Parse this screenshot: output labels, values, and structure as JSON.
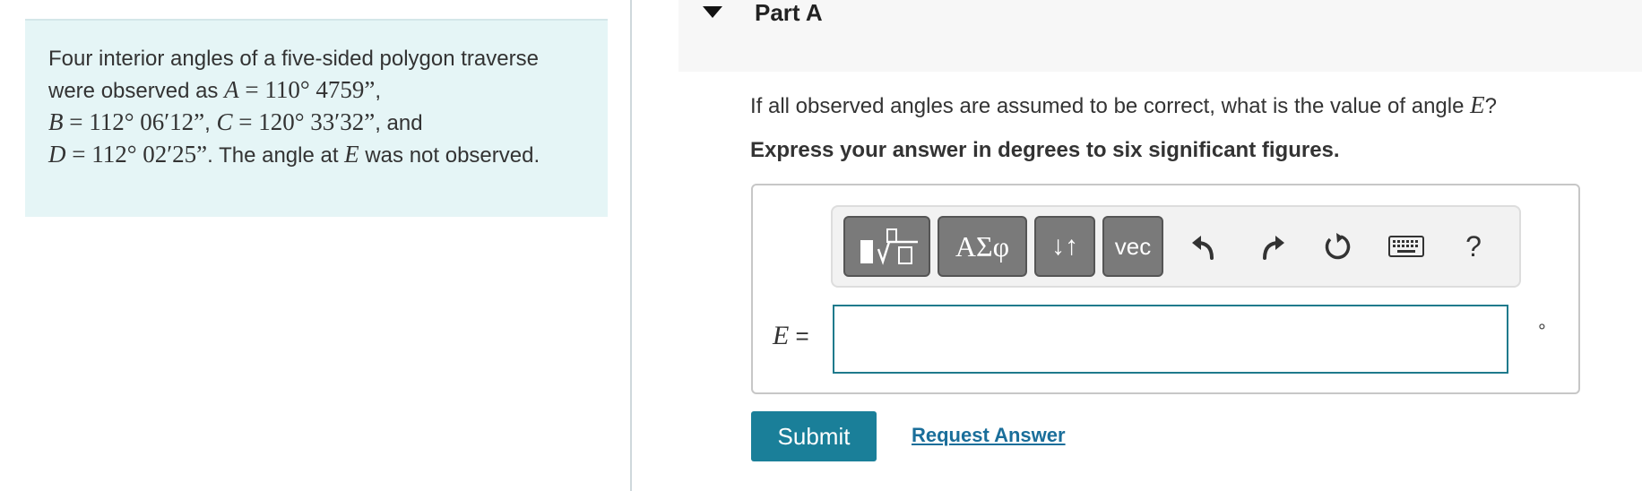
{
  "problem": {
    "t1": "Four interior angles of a five-sided polygon traverse were observed as ",
    "A_var": "A",
    "A_eq": " = 110° 4759”",
    "sep1": ",",
    "B_var": "B",
    "B_eq": " = 112° 06′12”",
    "sep2": ", ",
    "C_var": "C",
    "C_eq": " = 120° 33′32”",
    "sep3": ", and",
    "D_var": "D",
    "D_eq": " = 112° 02′25”",
    "t2": ". The angle at ",
    "E_var": "E",
    "t3": " was not observed."
  },
  "part": {
    "title": "Part A"
  },
  "question": {
    "text": "If all observed angles are assumed to be correct, what is the value of angle ",
    "var": "E",
    "end": "?"
  },
  "instruction": "Express your answer in degrees to six significant figures.",
  "toolbar": {
    "greek_label": "ΑΣφ",
    "arrows_label": "↓↑",
    "vec_label": "vec",
    "help_label": "?"
  },
  "answer": {
    "var": "E",
    "equals": " =",
    "value": "",
    "unit": "°"
  },
  "buttons": {
    "submit": "Submit",
    "request": "Request Answer"
  },
  "colors": {
    "panel_bg": "#e5f5f6",
    "submit_bg": "#1a7f99",
    "input_border": "#1f7a8c",
    "link": "#1a6e9a"
  },
  "icons": [
    "templates-icon",
    "undo-icon",
    "redo-icon",
    "reset-icon",
    "keyboard-icon"
  ]
}
